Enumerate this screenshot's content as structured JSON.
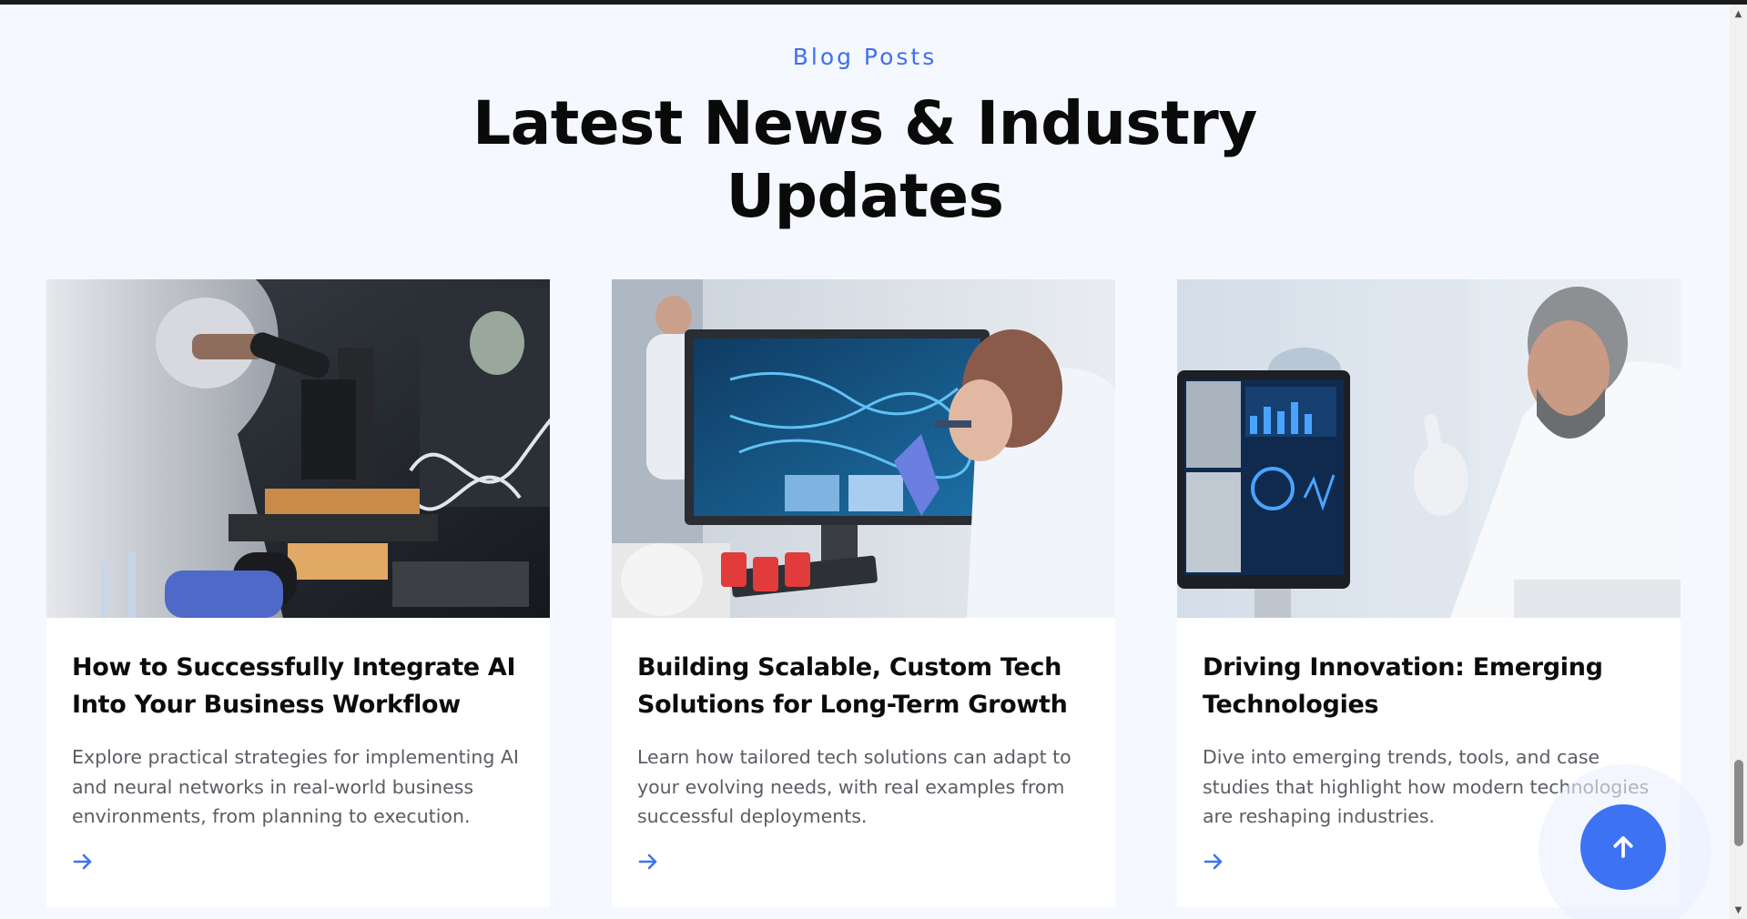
{
  "section": {
    "eyebrow": "Blog Posts",
    "heading_line1": "Latest News & Industry",
    "heading_line2": "Updates"
  },
  "posts": [
    {
      "title": "How to Successfully Integrate AI Into Your Business Workflow",
      "excerpt": "Explore practical strategies for implementing AI and neural networks in real-world business environments, from planning to execution.",
      "image": "scientist-microscope-dna-photo"
    },
    {
      "title": "Building Scalable, Custom Tech Solutions for Long-Term Growth",
      "excerpt": "Learn how tailored tech solutions can adapt to your evolving needs, with real examples from successful deployments.",
      "image": "researcher-monitor-dna-photo"
    },
    {
      "title": "Driving Innovation: Emerging Technologies",
      "excerpt": "Dive into emerging trends, tools, and case studies that highlight how modern technologies are reshaping industries.",
      "image": "scientist-data-screen-photo"
    }
  ],
  "colors": {
    "accent": "#3d72f2",
    "background": "#f5f8ff",
    "heading": "#0a0a0a",
    "body_text": "#5a5d63"
  },
  "icons": {
    "read_more": "arrow-right-icon",
    "back_to_top": "arrow-up-icon"
  }
}
